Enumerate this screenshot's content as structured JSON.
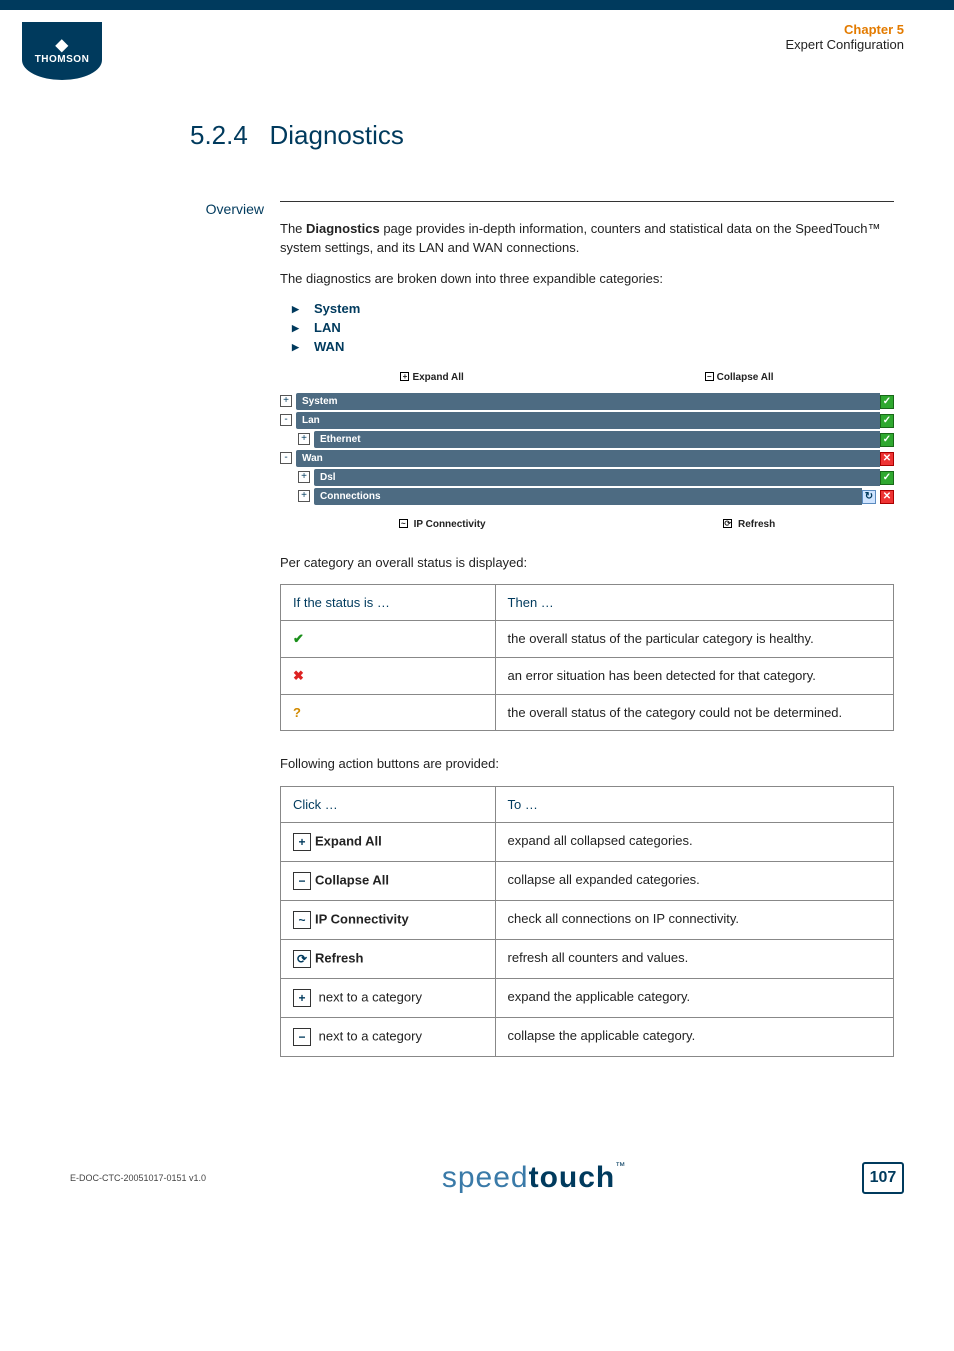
{
  "header": {
    "logo_text": "THOMSON",
    "chapter": "Chapter 5",
    "subtitle": "Expert Configuration"
  },
  "section": {
    "number": "5.2.4",
    "title": "Diagnostics"
  },
  "overview": {
    "label": "Overview",
    "intro_prefix": "The ",
    "intro_bold": "Diagnostics",
    "intro_suffix": " page provides in-depth information, counters and statistical data on the SpeedTouch™ system settings, and its LAN and WAN connections.",
    "broken_down": "The diagnostics are broken down into three expandible categories:",
    "bullets": [
      "System",
      "LAN",
      "WAN"
    ]
  },
  "diag": {
    "expand_all": "Expand All",
    "collapse_all": "Collapse All",
    "rows": [
      {
        "label": "System",
        "indent": 0,
        "toggle": "+",
        "status": [
          "ok"
        ]
      },
      {
        "label": "Lan",
        "indent": 0,
        "toggle": "-",
        "status": [
          "ok"
        ]
      },
      {
        "label": "Ethernet",
        "indent": 1,
        "toggle": "+",
        "status": [
          "ok"
        ]
      },
      {
        "label": "Wan",
        "indent": 0,
        "toggle": "-",
        "status": [
          "err"
        ]
      },
      {
        "label": "Dsl",
        "indent": 1,
        "toggle": "+",
        "status": [
          "ok"
        ]
      },
      {
        "label": "Connections",
        "indent": 1,
        "toggle": "+",
        "status": [
          "ref",
          "err"
        ]
      }
    ],
    "ip_connectivity": "IP Connectivity",
    "refresh": "Refresh"
  },
  "status_caption": "Per category an overall status is displayed:",
  "status_table": {
    "h1": "If the status is …",
    "h2": "Then …",
    "rows": [
      {
        "icon": "ok",
        "text": "the overall status of the particular category is healthy."
      },
      {
        "icon": "err",
        "text": "an error situation has been detected for that category."
      },
      {
        "icon": "unk",
        "text": "the overall status of the category could not be determined."
      }
    ]
  },
  "action_caption": "Following action buttons are provided:",
  "action_table": {
    "h1": "Click …",
    "h2": "To …",
    "rows": [
      {
        "icon": "+",
        "label": "Expand All",
        "bold": true,
        "text": "expand all collapsed categories."
      },
      {
        "icon": "−",
        "label": "Collapse All",
        "bold": true,
        "text": "collapse all expanded categories."
      },
      {
        "icon": "~",
        "label": "IP Connectivity",
        "bold": true,
        "text": "check all connections on IP connectivity."
      },
      {
        "icon": "⟳",
        "label": "Refresh",
        "bold": true,
        "text": "refresh all counters and values."
      },
      {
        "icon": "+",
        "label": " next to a category",
        "bold": false,
        "text": "expand the applicable category."
      },
      {
        "icon": "−",
        "label": " next to a category",
        "bold": false,
        "text": "collapse the applicable category."
      }
    ]
  },
  "footer": {
    "doc_id": "E-DOC-CTC-20051017-0151 v1.0",
    "brand_a": "speed",
    "brand_b": "touch",
    "page": "107"
  }
}
